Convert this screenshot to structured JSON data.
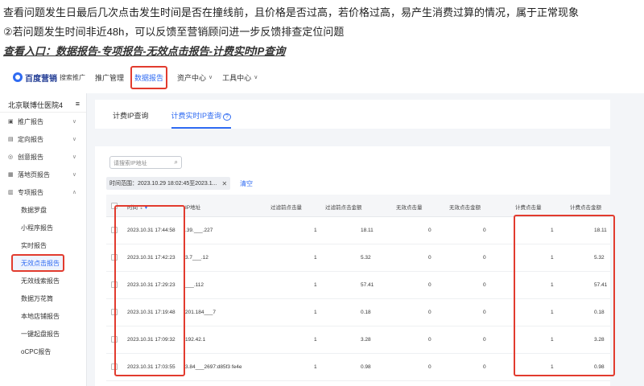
{
  "doc": {
    "line1": "查看问题发生日最后几次点击发生时间是否在撞线前，且价格是否过高，若价格过高，易产生消费过算的情况，属于正常现象",
    "line2": "②若问题发生时间非近48h，可以反馈至营销顾问进一步反馈排查定位问题",
    "line3": "查看入口：数据报告-专项报告-无效点击报告-计费实时IP查询"
  },
  "nav": {
    "logo": "百度营销",
    "logo_sub": "搜索推广",
    "items": [
      {
        "label": "推广管理"
      },
      {
        "label": "数据报告"
      },
      {
        "label": "资产中心"
      },
      {
        "label": "工具中心"
      }
    ]
  },
  "sidebar": {
    "account": "北京联博仕医院4",
    "groups": [
      {
        "label": "推广报告",
        "icon": "chart-icon"
      },
      {
        "label": "定向报告",
        "icon": "target-icon"
      },
      {
        "label": "创意报告",
        "icon": "idea-icon"
      },
      {
        "label": "落地页报告",
        "icon": "page-icon"
      },
      {
        "label": "专项报告",
        "icon": "special-icon"
      }
    ],
    "subitems": [
      {
        "label": "数据罗盘"
      },
      {
        "label": "小程序报告"
      },
      {
        "label": "实时报告"
      },
      {
        "label": "无效点击报告"
      },
      {
        "label": "无效线索报告"
      },
      {
        "label": "数据万花筒"
      },
      {
        "label": "本地店铺报告"
      },
      {
        "label": "一键起盘报告"
      },
      {
        "label": "oCPC报告"
      }
    ]
  },
  "tabs": [
    {
      "label": "计费IP查询"
    },
    {
      "label": "计费实时IP查询"
    }
  ],
  "search": {
    "placeholder": "请搜索IP地址"
  },
  "filter": {
    "label": "时间范围：2023.10.29 18:02:45至2023.1..."
  },
  "clear_label": "清空",
  "table": {
    "headers": [
      "时间",
      "IP地址",
      "过滤前点击量",
      "过滤前点击金额",
      "无效点击量",
      "无效点击金额",
      "计费点击量",
      "计费点击金额"
    ],
    "rows": [
      {
        "time": "2023.10.31 17:44:58",
        "ip": ".39.___.227",
        "c1": "1",
        "c2": "18.11",
        "c3": "0",
        "c4": "0",
        "c5": "1",
        "c6": "18.11"
      },
      {
        "time": "2023.10.31 17:42:23",
        "ip": "3.7___.12",
        "c1": "1",
        "c2": "5.32",
        "c3": "0",
        "c4": "0",
        "c5": "1",
        "c6": "5.32"
      },
      {
        "time": "2023.10.31 17:29:23",
        "ip": "___.112",
        "c1": "1",
        "c2": "57.41",
        "c3": "0",
        "c4": "0",
        "c5": "1",
        "c6": "57.41"
      },
      {
        "time": "2023.10.31 17:19:48",
        "ip": "201.184___7",
        "c1": "1",
        "c2": "0.18",
        "c3": "0",
        "c4": "0",
        "c5": "1",
        "c6": "0.18"
      },
      {
        "time": "2023.10.31 17:09:32",
        "ip": "192.42.1",
        "c1": "1",
        "c2": "3.28",
        "c3": "0",
        "c4": "0",
        "c5": "1",
        "c6": "3.28"
      },
      {
        "time": "2023.10.31 17:03:55",
        "ip": "3.84___2697:d85f3 fe4e",
        "c1": "1",
        "c2": "0.98",
        "c3": "0",
        "c4": "0",
        "c5": "1",
        "c6": "0.98"
      }
    ]
  },
  "colors": {
    "accent": "#2f6bf2",
    "highlight": "#e23b2e"
  }
}
